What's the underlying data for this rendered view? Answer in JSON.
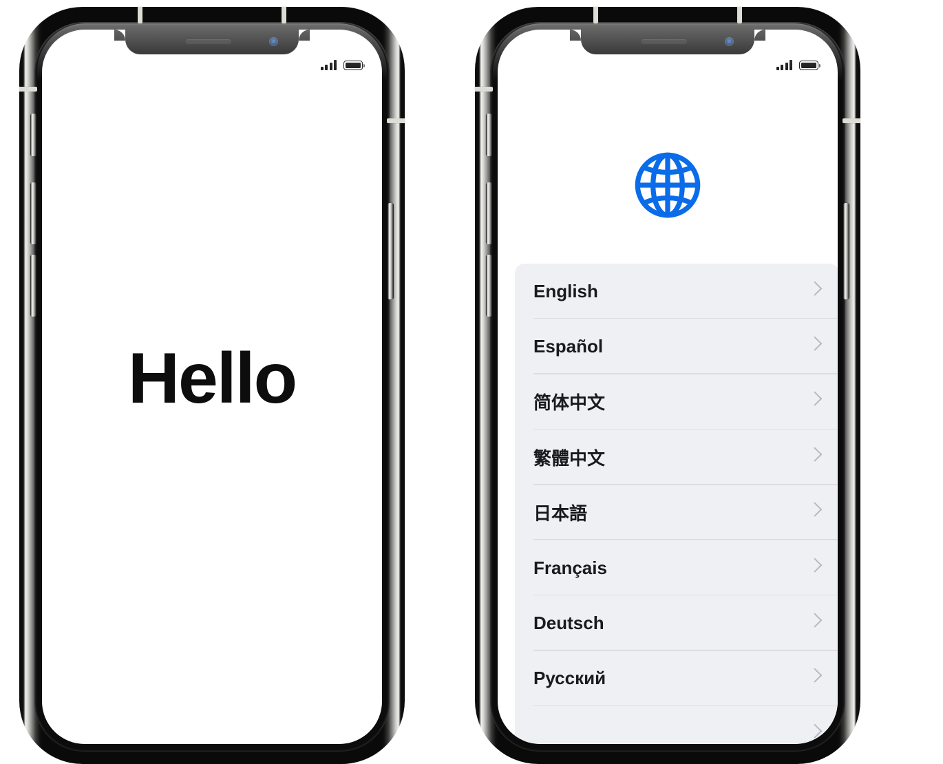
{
  "page": {
    "background_color": "#ffffff",
    "description": "Two iPhone X devices side by side showing iOS setup screens"
  },
  "phones": [
    {
      "name": "hello-screen",
      "status_bar": {
        "signal_icon": "signal-bars-icon",
        "signal_bars_filled": 4,
        "signal_bars_total": 4,
        "battery_icon": "battery-icon",
        "battery_level_percent": 100
      },
      "hardware": {
        "speaker_icon": "earpiece-speaker-icon",
        "camera_icon": "front-camera-icon",
        "mute_switch": "mute-switch-button",
        "volume_up": "volume-up-button",
        "volume_down": "volume-down-button",
        "power": "side-power-button"
      },
      "content": {
        "greeting": "Hello",
        "text_color": "#0d0d0d"
      }
    },
    {
      "name": "language-screen",
      "status_bar": {
        "signal_icon": "signal-bars-icon",
        "signal_bars_filled": 4,
        "signal_bars_total": 4,
        "battery_icon": "battery-icon",
        "battery_level_percent": 100
      },
      "hardware": {
        "speaker_icon": "earpiece-speaker-icon",
        "camera_icon": "front-camera-icon",
        "mute_switch": "mute-switch-button",
        "volume_up": "volume-up-button",
        "volume_down": "volume-down-button",
        "power": "side-power-button"
      },
      "content": {
        "globe_icon": "globe-icon",
        "globe_color": "#0a6ce8",
        "list_background": "#eff0f4",
        "separator_color": "#dcdce1",
        "chevron_icon": "chevron-right-icon",
        "chevron_color": "#b9b9bf",
        "languages": [
          {
            "label": "English"
          },
          {
            "label": "Español"
          },
          {
            "label": "简体中文"
          },
          {
            "label": "繁體中文"
          },
          {
            "label": "日本語"
          },
          {
            "label": "Français"
          },
          {
            "label": "Deutsch"
          },
          {
            "label": "Русский"
          },
          {
            "label": ""
          }
        ]
      }
    }
  ]
}
